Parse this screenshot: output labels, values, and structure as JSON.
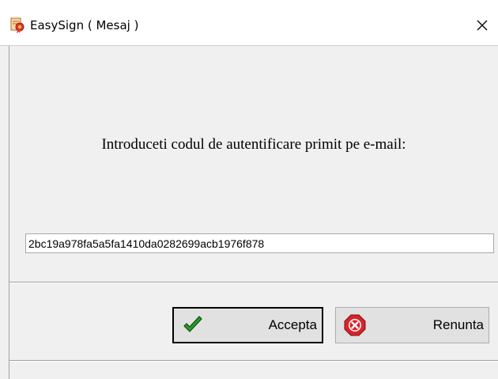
{
  "window": {
    "title": "EasySign ( Mesaj )",
    "close_label": "×"
  },
  "prompt": {
    "text": "Introduceti codul de autentificare primit pe e-mail:"
  },
  "code_field": {
    "value": "2bc19a978fa5a5fa1410da0282699acb1976f878"
  },
  "buttons": {
    "accept_label": "Accepta",
    "cancel_label": "Renunta"
  },
  "icons": {
    "app": "certificate-ribbon-icon",
    "accept": "green-checkmark-icon",
    "cancel": "red-stop-x-icon"
  },
  "colors": {
    "accept_check": "#2a9a2a",
    "cancel_red": "#d8232a"
  }
}
